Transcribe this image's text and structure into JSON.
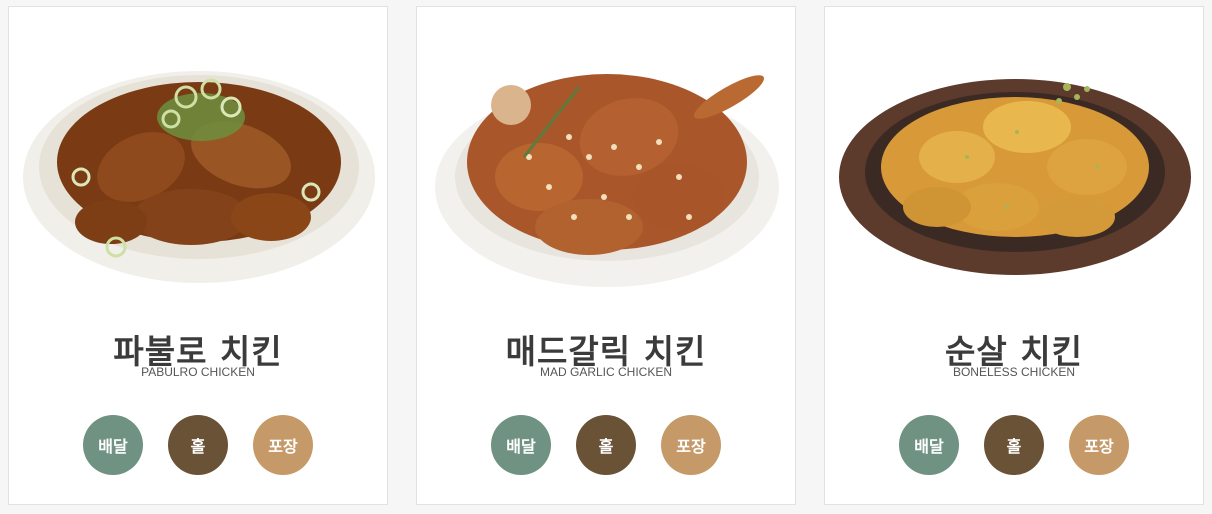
{
  "menus": [
    {
      "title": "파불로 치킨",
      "subtitle": "PABULRO CHICKEN",
      "image": "green-onion-soy-glazed-chicken-photo",
      "buttons": [
        "배달",
        "홀",
        "포장"
      ]
    },
    {
      "title": "매드갈릭 치킨",
      "subtitle": "MAD GARLIC CHICKEN",
      "image": "garlic-fried-chicken-photo",
      "buttons": [
        "배달",
        "홀",
        "포장"
      ]
    },
    {
      "title": "순살 치킨",
      "subtitle": "BONELESS CHICKEN",
      "image": "boneless-fried-chicken-photo",
      "buttons": [
        "배달",
        "홀",
        "포장"
      ]
    }
  ],
  "colors": {
    "delivery": "#6f9282",
    "hall": "#6a5236",
    "takeout": "#c69a68",
    "title": "#3b3b3b"
  }
}
